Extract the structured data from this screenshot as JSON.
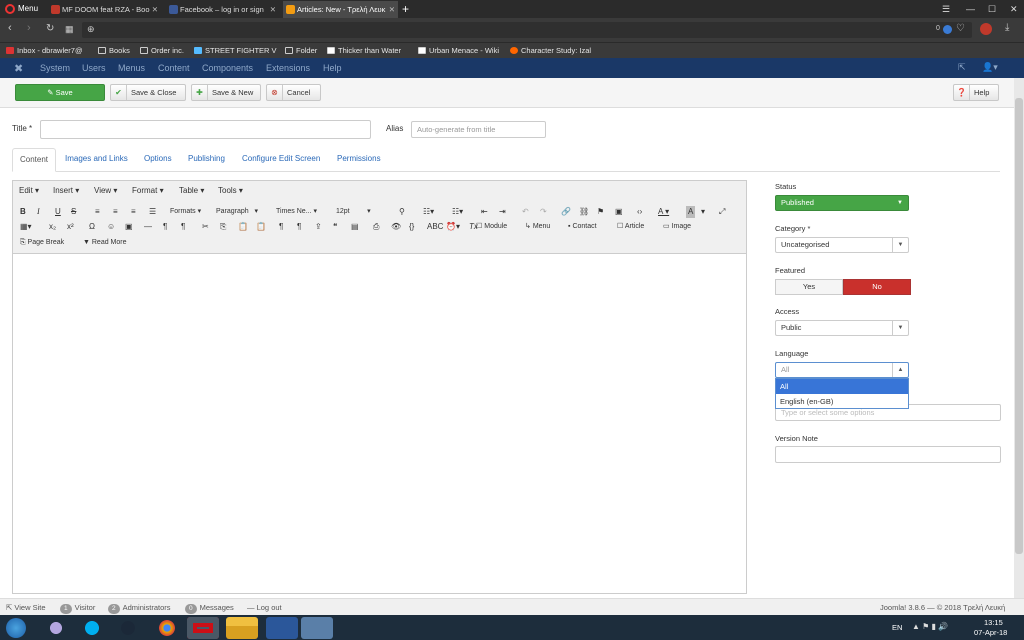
{
  "browser": {
    "menu_label": "Menu",
    "tabs": [
      {
        "title": "MF DOOM feat RZA - Boo",
        "color": "#c0392b"
      },
      {
        "title": "Facebook – log in or sign",
        "color": "#3b5998"
      },
      {
        "title": "Articles: New - Τρελή Λευκ",
        "color": "#f39c12"
      }
    ],
    "new_tab": "+",
    "zoom_badge": "0",
    "bookmarks": [
      {
        "label": "Inbox - dbrawler7@",
        "icon": "mail-icon"
      },
      {
        "label": "Books",
        "icon": "folder-icon"
      },
      {
        "label": "Order inc.",
        "icon": "folder-icon"
      },
      {
        "label": "STREET FIGHTER V S",
        "icon": "game-icon"
      },
      {
        "label": "Folder",
        "icon": "folder-icon"
      },
      {
        "label": "Thicker than Water",
        "icon": "wiki-icon"
      },
      {
        "label": "Urban Menace - Wiki",
        "icon": "wiki-icon"
      },
      {
        "label": "Character Study: Izal",
        "icon": "reddit-icon"
      }
    ]
  },
  "joomla": {
    "nav": [
      "System",
      "Users",
      "Menus",
      "Content",
      "Components",
      "Extensions",
      "Help"
    ],
    "toolbar": {
      "save": "Save",
      "save_close": "Save & Close",
      "save_new": "Save & New",
      "cancel": "Cancel",
      "help": "Help"
    },
    "title_label": "Title *",
    "title_value": "",
    "alias_label": "Alias",
    "alias_placeholder": "Auto-generate from title",
    "tabs": [
      "Content",
      "Images and Links",
      "Options",
      "Publishing",
      "Configure Edit Screen",
      "Permissions"
    ],
    "editor": {
      "menus": [
        "Edit",
        "Insert",
        "View",
        "Format",
        "Table",
        "Tools"
      ],
      "formats": "Formats",
      "paragraph": "Paragraph",
      "font": "Times Ne...",
      "size": "12pt",
      "row3": [
        "Module",
        "Menu",
        "Contact",
        "Article",
        "Image"
      ],
      "page_break": "Page Break",
      "read_more": "Read More"
    },
    "side": {
      "status_label": "Status",
      "status_value": "Published",
      "category_label": "Category *",
      "category_value": "Uncategorised",
      "featured_label": "Featured",
      "featured_yes": "Yes",
      "featured_no": "No",
      "access_label": "Access",
      "access_value": "Public",
      "language_label": "Language",
      "language_value": "All",
      "language_options": [
        "All",
        "English (en-GB)"
      ],
      "tags_placeholder": "Type or select some options",
      "version_label": "Version Note"
    },
    "status_bar": {
      "view_site": "View Site",
      "visitor_count": "1",
      "visitor": "Visitor",
      "admin_count": "2",
      "admins": "Administrators",
      "msg_count": "0",
      "messages": "Messages",
      "logout": "Log out",
      "version": "Joomla! 3.8.6 — © 2018 Τρελή Λευκή"
    }
  },
  "taskbar": {
    "lang": "EN",
    "time": "13:15",
    "date": "07-Apr-18"
  }
}
